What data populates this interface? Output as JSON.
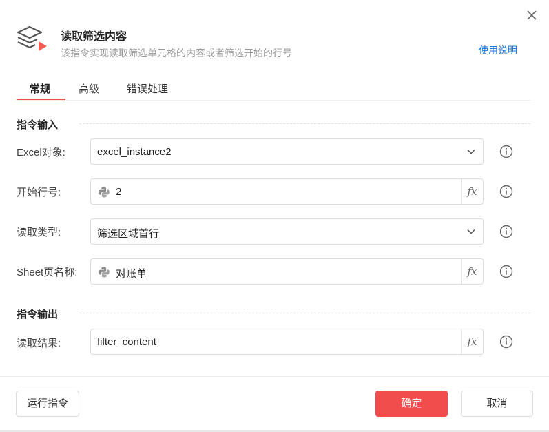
{
  "header": {
    "title": "读取筛选内容",
    "subtitle": "该指令实现读取筛选单元格的内容或者筛选开始的行号",
    "help_link": "使用说明"
  },
  "tabs": [
    {
      "label": "常规",
      "active": true
    },
    {
      "label": "高级",
      "active": false
    },
    {
      "label": "错误处理",
      "active": false
    }
  ],
  "sections": {
    "input": "指令输入",
    "output": "指令输出"
  },
  "fields": {
    "excel_object": {
      "label": "Excel对象:",
      "value": "excel_instance2",
      "type": "select"
    },
    "start_row": {
      "label": "开始行号:",
      "value": "2",
      "type": "python-expression"
    },
    "read_type": {
      "label": "读取类型:",
      "value": "筛选区域首行",
      "type": "select"
    },
    "sheet_name": {
      "label": "Sheet页名称:",
      "value": "对账单",
      "type": "python-expression"
    },
    "read_result": {
      "label": "读取结果:",
      "value": "filter_content",
      "type": "text"
    }
  },
  "fx_label": "fx",
  "footer": {
    "run_label": "运行指令",
    "ok_label": "确定",
    "cancel_label": "取消"
  },
  "colors": {
    "accent": "#f24d4d",
    "link": "#1f7ad8"
  },
  "icons": {
    "app": "layers-play-icon",
    "close": "close-icon",
    "dropdown": "chevron-down-icon",
    "python": "python-icon",
    "info": "info-circle-icon"
  }
}
